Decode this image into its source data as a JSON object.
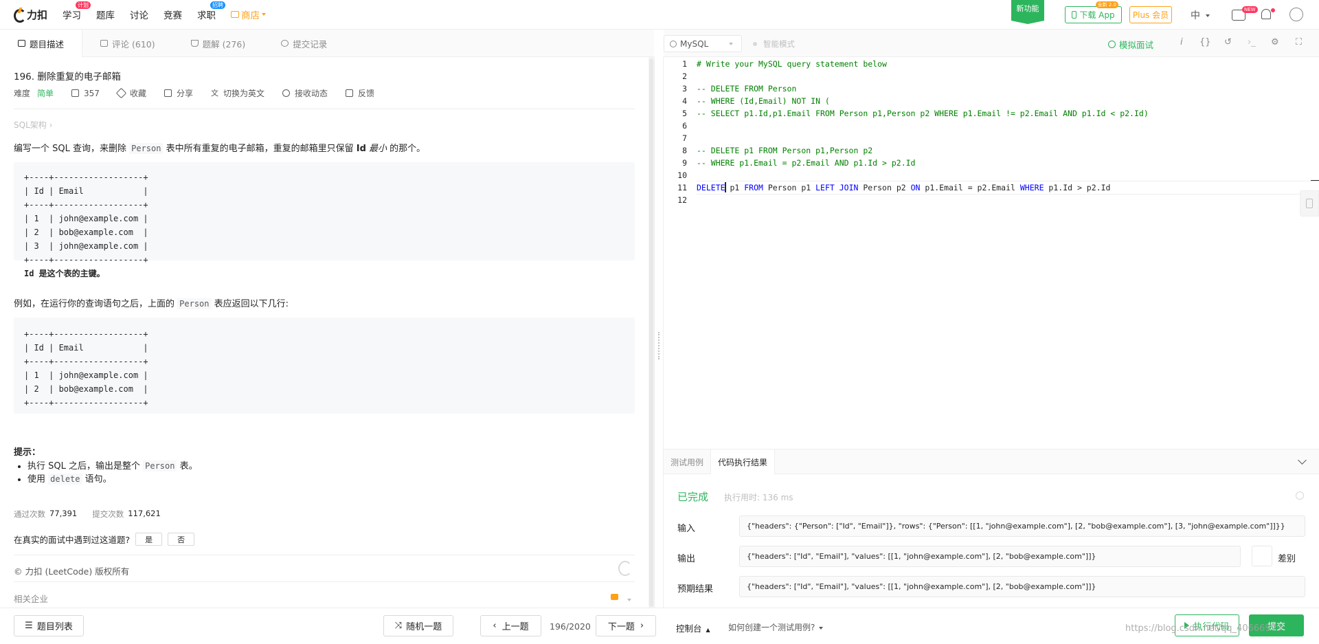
{
  "nav": {
    "brand": "力扣",
    "items": [
      {
        "label": "学习",
        "badge": "计划",
        "badge_color": "#ff375f"
      },
      {
        "label": "题库"
      },
      {
        "label": "讨论"
      },
      {
        "label": "竞赛"
      },
      {
        "label": "求职",
        "badge": "招聘",
        "badge_color": "#1890ff"
      }
    ],
    "shop": "商店",
    "new_feature": "新功能",
    "download_app": "下载 App",
    "download_badge": "全新 2.0",
    "plus": "Plus 会员",
    "lang": "中",
    "video_badge": "NEW"
  },
  "left_tabs": [
    {
      "label": "题目描述",
      "icon": "description-icon"
    },
    {
      "label": "评论 (610)",
      "icon": "comment-icon"
    },
    {
      "label": "题解 (276)",
      "icon": "solution-icon"
    },
    {
      "label": "提交记录",
      "icon": "history-icon"
    }
  ],
  "problem": {
    "title": "196. 删除重复的电子邮箱",
    "difficulty_label": "难度",
    "difficulty": "简单",
    "likes": "357",
    "favorite": "收藏",
    "share": "分享",
    "switch_lang": "切换为英文",
    "subscribe": "接收动态",
    "feedback": "反馈",
    "sql_arch": "SQL架构 ›",
    "desc_1": "编写一个 SQL 查询，来删除 ",
    "desc_code": "Person",
    "desc_2": " 表中所有重复的电子邮箱，重复的邮箱里只保留 ",
    "desc_bold": "Id",
    "desc_3": " 最小",
    "desc_4": " 的那个。",
    "table1": "+----+------------------+\n| Id | Email            |\n+----+------------------+\n| 1  | john@example.com |\n| 2  | bob@example.com  |\n| 3  | john@example.com |\n+----+------------------+",
    "table1_note": "Id 是这个表的主键。",
    "example_1": "例如，在运行你的查询语句之后，上面的 ",
    "example_code": "Person",
    "example_2": " 表应返回以下几行:",
    "table2": "+----+------------------+\n| Id | Email            |\n+----+------------------+\n| 1  | john@example.com |\n| 2  | bob@example.com  |\n+----+------------------+",
    "hint_title": "提示：",
    "hint1_a": "执行 SQL 之后，输出是整个 ",
    "hint1_code": "Person",
    "hint1_b": " 表。",
    "hint2_a": "使用 ",
    "hint2_code": "delete",
    "hint2_b": " 语句。",
    "accepted_label": "通过次数",
    "accepted": "77,391",
    "submitted_label": "提交次数",
    "submitted": "117,621",
    "interview_q": "在真实的面试中遇到过这道题?",
    "yes": "是",
    "no": "否",
    "copyright": "© 力扣 (LeetCode) 版权所有",
    "related": "相关企业"
  },
  "bottom_left": {
    "list": "题目列表",
    "random": "随机一题",
    "prev": "上一题",
    "pager": "196/2020",
    "next": "下一题"
  },
  "editor": {
    "language": "MySQL",
    "smart_mode": "智能模式",
    "mock_interview": "模拟面试",
    "lines": [
      {
        "n": "1",
        "parts": [
          {
            "t": "# Write your MySQL query statement below",
            "c": "cm"
          }
        ]
      },
      {
        "n": "2",
        "parts": []
      },
      {
        "n": "3",
        "parts": [
          {
            "t": "-- DELETE FROM Person",
            "c": "cm"
          }
        ]
      },
      {
        "n": "4",
        "parts": [
          {
            "t": "-- WHERE (Id,Email) NOT IN (",
            "c": "cm"
          }
        ]
      },
      {
        "n": "5",
        "parts": [
          {
            "t": "-- SELECT p1.Id,p1.Email FROM Person p1,Person p2 WHERE p1.Email != p2.Email AND p1.Id < p2.Id)",
            "c": "cm"
          }
        ]
      },
      {
        "n": "6",
        "parts": []
      },
      {
        "n": "7",
        "parts": []
      },
      {
        "n": "8",
        "parts": [
          {
            "t": "-- DELETE p1 FROM Person p1,Person p2",
            "c": "cm"
          }
        ]
      },
      {
        "n": "9",
        "parts": [
          {
            "t": "-- WHERE p1.Email = p2.Email AND p1.Id > p2.Id",
            "c": "cm"
          }
        ]
      },
      {
        "n": "10",
        "parts": []
      },
      {
        "n": "11",
        "parts": [
          {
            "t": "DELETE",
            "c": "kw"
          },
          {
            "t": " p1 ",
            "c": ""
          },
          {
            "t": "FROM",
            "c": "kw"
          },
          {
            "t": " Person p1 ",
            "c": ""
          },
          {
            "t": "LEFT JOIN",
            "c": "kw"
          },
          {
            "t": " Person p2 ",
            "c": ""
          },
          {
            "t": "ON",
            "c": "kw"
          },
          {
            "t": " p1.Email = p2.Email ",
            "c": ""
          },
          {
            "t": "WHERE",
            "c": "kw"
          },
          {
            "t": " p1.Id > p2.Id",
            "c": ""
          }
        ]
      },
      {
        "n": "12",
        "parts": []
      }
    ]
  },
  "results": {
    "tab_testcase": "测试用例",
    "tab_result": "代码执行结果",
    "status": "已完成",
    "runtime": "执行用时: 136 ms",
    "input_label": "输入",
    "input": "{\"headers\": {\"Person\": [\"Id\", \"Email\"]}, \"rows\": {\"Person\": [[1, \"john@example.com\"], [2, \"bob@example.com\"], [3, \"john@example.com\"]]}}",
    "output_label": "输出",
    "output": "{\"headers\": [\"Id\", \"Email\"], \"values\": [[1, \"john@example.com\"], [2, \"bob@example.com\"]]}",
    "diff": "差别",
    "expected_label": "预期结果",
    "expected": "{\"headers\": [\"Id\", \"Email\"], \"values\": [[1, \"john@example.com\"], [2, \"bob@example.com\"]]}"
  },
  "bottom_right": {
    "console": "控制台",
    "howto": "如何创建一个测试用例?",
    "run": "执行代码",
    "submit": "提交"
  },
  "watermark": "https://blog.csdn.net/qq_40666979"
}
